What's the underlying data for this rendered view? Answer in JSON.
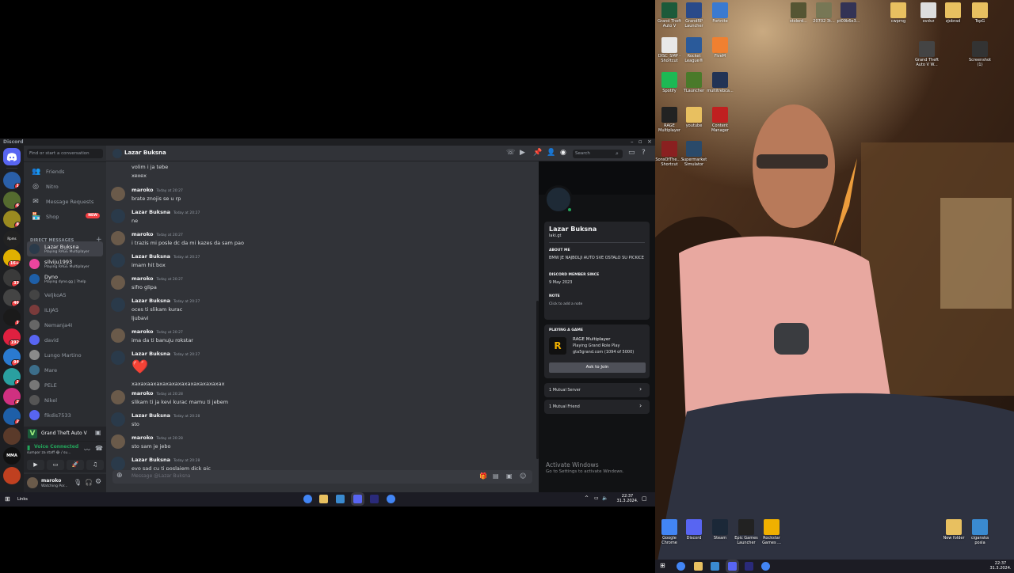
{
  "window": {
    "title": "Discord"
  },
  "search": {
    "placeholder": "Find or start a conversation"
  },
  "nav": [
    {
      "label": "Friends",
      "icon": "friends-icon"
    },
    {
      "label": "Nitro",
      "icon": "nitro-icon"
    },
    {
      "label": "Message Requests",
      "icon": "mail-icon"
    },
    {
      "label": "Shop",
      "icon": "shop-icon",
      "badge": "NEW"
    }
  ],
  "dm_header": "DIRECT MESSAGES",
  "dms": [
    {
      "name": "Lazar Buksna",
      "status": "Playing RAGE Multiplayer",
      "color": "#2a3a4a"
    },
    {
      "name": "silviju1993",
      "status": "Playing RAGE Multiplayer",
      "color": "#eb459e"
    },
    {
      "name": "Dyno",
      "status": "Playing dyno.gg | ?help",
      "color": "#1e5fa8"
    },
    {
      "name": "VeljkoA5",
      "status": "",
      "color": "#444"
    },
    {
      "name": "ILIJA5",
      "status": "",
      "color": "#7a3b3b"
    },
    {
      "name": "Nemanja4I",
      "status": "",
      "color": "#666"
    },
    {
      "name": "david",
      "status": "",
      "color": "#5865f2"
    },
    {
      "name": "Lungo Martino",
      "status": "",
      "color": "#8a8a8a"
    },
    {
      "name": "Mare",
      "status": "",
      "color": "#3c6e8a"
    },
    {
      "name": "PELE",
      "status": "",
      "color": "#777"
    },
    {
      "name": "Nikel",
      "status": "",
      "color": "#555"
    },
    {
      "name": "fikdis7533",
      "status": "",
      "color": "#5865f2"
    }
  ],
  "guild_badges": [
    "1",
    "6",
    "8",
    "16+",
    "33",
    "46",
    "1",
    "192",
    "94",
    "1",
    "2",
    "2"
  ],
  "game_bar": {
    "label": "Grand Theft Auto V"
  },
  "voice": {
    "status": "Voice Connected",
    "channel": "sumpor za staff 😂 / su..."
  },
  "user": {
    "name": "maroko",
    "status": "Watching Por..."
  },
  "channel_header": {
    "name": "Lazar Buksna",
    "search_placeholder": "Search"
  },
  "messages": [
    {
      "author": "",
      "time": "",
      "lines": [
        "volim i ja tebe",
        "xexex"
      ],
      "continued": true
    },
    {
      "author": "maroko",
      "time": "Today at 20:27",
      "lines": [
        "brate znojis se u rp"
      ]
    },
    {
      "author": "Lazar Buksna",
      "time": "Today at 20:27",
      "lines": [
        "ne"
      ]
    },
    {
      "author": "maroko",
      "time": "Today at 20:27",
      "lines": [
        "i trazis mi posle dc da mi kazes da sam pao"
      ]
    },
    {
      "author": "Lazar Buksna",
      "time": "Today at 20:27",
      "lines": [
        "imam hit box"
      ]
    },
    {
      "author": "maroko",
      "time": "Today at 20:27",
      "lines": [
        "sifro glipa"
      ]
    },
    {
      "author": "Lazar Buksna",
      "time": "Today at 20:27",
      "lines": [
        "oces ti slikam kurac",
        "ljubavi"
      ]
    },
    {
      "author": "maroko",
      "time": "Today at 20:27",
      "lines": [
        "ima da ti banuju rokstar"
      ]
    },
    {
      "author": "Lazar Buksna",
      "time": "Today at 20:27",
      "lines": [
        "❤️",
        "xaxaxaaxaxaxaxaxaxaxaxaxaxaxax"
      ],
      "heart": true
    },
    {
      "author": "maroko",
      "time": "Today at 20:28",
      "lines": [
        "slikam ti ja kevi kurac mamu ti jebem"
      ]
    },
    {
      "author": "Lazar Buksna",
      "time": "Today at 20:28",
      "lines": [
        "sto"
      ]
    },
    {
      "author": "maroko",
      "time": "Today at 20:28",
      "lines": [
        "sto sam je jebo"
      ]
    },
    {
      "author": "Lazar Buksna",
      "time": "Today at 20:28",
      "lines": [
        "evo sad cu ti poslajem dick pic"
      ]
    }
  ],
  "composer": {
    "placeholder": "Message @Lazar Buksna"
  },
  "profile": {
    "name": "Lazar Buksna",
    "tag": "laki.gt",
    "about_label": "ABOUT ME",
    "about": "BMW JE NAJBOLJI AUTO SVE OSTALO SU PICKICE",
    "since_label": "DISCORD MEMBER SINCE",
    "since": "9 May 2023",
    "note_label": "NOTE",
    "note": "Click to add a note",
    "playing_label": "PLAYING A GAME",
    "game": "RAGE Multiplayer",
    "game_detail": "Playing Grand Role Play",
    "game_server": "gta5grand.com (1094 of 5000)",
    "join": "Ask to Join",
    "mutual_server": "1 Mutual Server",
    "mutual_friend": "1 Mutual Friend"
  },
  "activate": {
    "title": "Activate Windows",
    "sub": "Go to Settings to activate Windows."
  },
  "taskbar_left": {
    "links": "Links",
    "time": "22:37",
    "date": "31.3.2024."
  },
  "desktop_icons": [
    {
      "label": "Grand Theft Auto V",
      "color": "#1c5a3a"
    },
    {
      "label": "GrandRP Launcher",
      "color": "#2a4a8a"
    },
    {
      "label": "Fortnite",
      "color": "#3a7ad0"
    },
    {
      "label": "DISC_SMP - Shortcut",
      "color": "#e8e8e8"
    },
    {
      "label": "Rocket League®",
      "color": "#2a5a9a"
    },
    {
      "label": "FiveM",
      "color": "#f08030"
    },
    {
      "label": "Spotify",
      "color": "#1db954"
    },
    {
      "label": "TLauncher",
      "color": "#4a7a2a"
    },
    {
      "label": "multitrebca...",
      "color": "#223355"
    },
    {
      "label": "RAGE Multiplayer",
      "color": "#222"
    },
    {
      "label": "youtube",
      "color": "#e8c060"
    },
    {
      "label": "Content Manager",
      "color": "#c02020"
    },
    {
      "label": "SonsOfThe... - Shortcut",
      "color": "#8a2020"
    },
    {
      "label": "Supermarket Simulator",
      "color": "#2a4a6a"
    },
    {
      "label": "Google Chrome",
      "color": "#4285f4"
    },
    {
      "label": "Discord",
      "color": "#5865f2"
    },
    {
      "label": "Steam",
      "color": "#1b2838"
    },
    {
      "label": "Epic Games Launcher",
      "color": "#222"
    },
    {
      "label": "Rockstar Games ...",
      "color": "#f0b000"
    },
    {
      "label": "New folder",
      "color": "#e8c060"
    },
    {
      "label": "ciganska posla",
      "color": "#3a8ad0"
    },
    {
      "label": "stolerd...",
      "color": "#553"
    },
    {
      "label": "20702 3t...",
      "color": "#775"
    },
    {
      "label": "pt09b6e3...",
      "color": "#335"
    },
    {
      "label": "cwprng",
      "color": "#e8c060"
    },
    {
      "label": "ovdvz",
      "color": "#ddd"
    },
    {
      "label": "zjobrad",
      "color": "#e8c060"
    },
    {
      "label": "TopG",
      "color": "#e8c060"
    },
    {
      "label": "Grand Theft Auto V W...",
      "color": "#444"
    },
    {
      "label": "Screenshot (1)",
      "color": "#333"
    }
  ],
  "taskbar_right": {
    "time": "22:37",
    "date": "31.3.2024."
  },
  "colors": {
    "bg": "#313338",
    "sidebar": "#2b2d31",
    "rail": "#1e1f22",
    "accent": "#5865f2",
    "green": "#23a55a",
    "red": "#f23f43"
  }
}
